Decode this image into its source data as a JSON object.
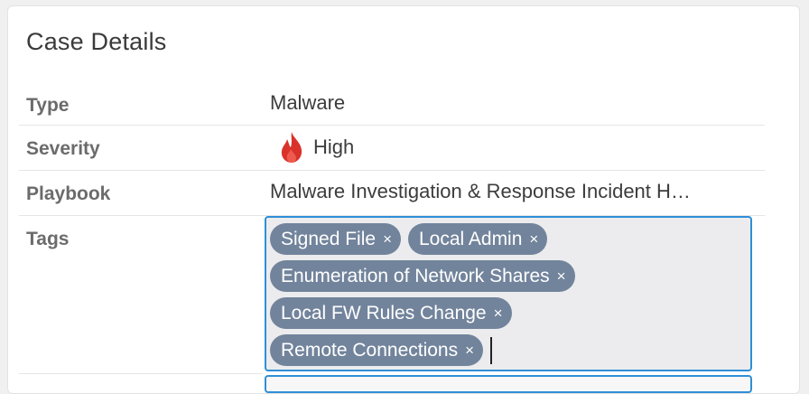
{
  "card": {
    "title": "Case Details"
  },
  "fields": {
    "type": {
      "label": "Type",
      "value": "Malware"
    },
    "severity": {
      "label": "Severity",
      "value": "High",
      "icon": "flame-icon",
      "icon_color": "#d9322a"
    },
    "playbook": {
      "label": "Playbook",
      "value": "Malware Investigation & Response Incident H…"
    },
    "tags": {
      "label": "Tags",
      "items": [
        {
          "label": "Signed File",
          "remove": "×"
        },
        {
          "label": "Local Admin",
          "remove": "×"
        },
        {
          "label": "Enumeration of Network Shares",
          "remove": "×"
        },
        {
          "label": "Local FW Rules Change",
          "remove": "×"
        },
        {
          "label": "Remote Connections",
          "remove": "×"
        }
      ]
    }
  },
  "colors": {
    "focus_border": "#2e8fd8",
    "tag_background": "#72849c",
    "tag_text": "#ffffff"
  }
}
